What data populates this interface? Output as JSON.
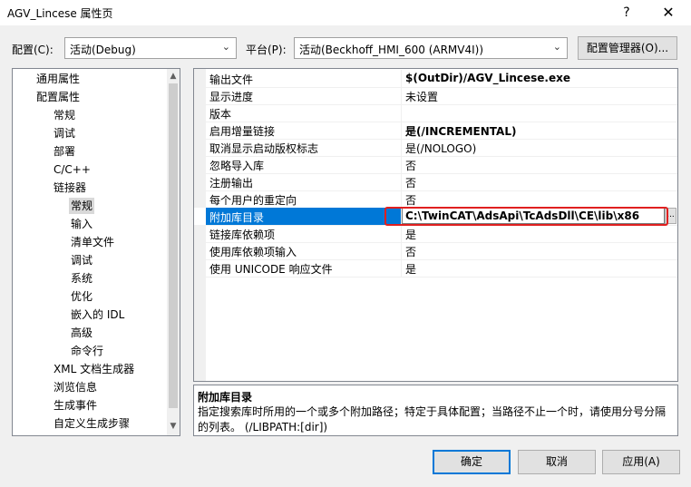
{
  "window": {
    "title": "AGV_Lincese 属性页",
    "help_glyph": "?",
    "close_glyph": "✕"
  },
  "config_bar": {
    "config_label": "配置(C):",
    "config_value": "活动(Debug)",
    "platform_label": "平台(P):",
    "platform_value": "活动(Beckhoff_HMI_600 (ARMV4I))",
    "config_manager_button": "配置管理器(O)..."
  },
  "tree": {
    "items": [
      {
        "label": "通用属性"
      },
      {
        "label": "配置属性"
      },
      {
        "label": "常规"
      },
      {
        "label": "调试"
      },
      {
        "label": "部署"
      },
      {
        "label": "C/C++"
      },
      {
        "label": "链接器"
      },
      {
        "label": "常规",
        "selected": true
      },
      {
        "label": "输入"
      },
      {
        "label": "清单文件"
      },
      {
        "label": "调试"
      },
      {
        "label": "系统"
      },
      {
        "label": "优化"
      },
      {
        "label": "嵌入的 IDL"
      },
      {
        "label": "高级"
      },
      {
        "label": "命令行"
      },
      {
        "label": "XML 文档生成器"
      },
      {
        "label": "浏览信息"
      },
      {
        "label": "生成事件"
      },
      {
        "label": "自定义生成步骤"
      }
    ]
  },
  "properties": {
    "rows": [
      {
        "name": "输出文件",
        "value": "$(OutDir)/AGV_Lincese.exe",
        "bold": true
      },
      {
        "name": "显示进度",
        "value": "未设置"
      },
      {
        "name": "版本",
        "value": ""
      },
      {
        "name": "启用增量链接",
        "value": "是(/INCREMENTAL)",
        "bold": true
      },
      {
        "name": "取消显示启动版权标志",
        "value": "是(/NOLOGO)"
      },
      {
        "name": "忽略导入库",
        "value": "否"
      },
      {
        "name": "注册输出",
        "value": "否"
      },
      {
        "name": "每个用户的重定向",
        "value": "否"
      },
      {
        "name": "附加库目录",
        "value": "C:\\TwinCAT\\AdsApi\\TcAdsDll\\CE\\lib\\x86",
        "selected": true,
        "bold": true
      },
      {
        "name": "链接库依赖项",
        "value": "是"
      },
      {
        "name": "使用库依赖项输入",
        "value": "否"
      },
      {
        "name": "使用 UNICODE 响应文件",
        "value": "是"
      }
    ],
    "edit_value": "C:\\TwinCAT\\AdsApi\\TcAdsDll\\CE\\lib\\x86",
    "ellipsis": "..."
  },
  "description": {
    "title": "附加库目录",
    "body": "指定搜索库时所用的一个或多个附加路径；特定于具体配置；当路径不止一个时，请使用分号分隔的列表。     (/LIBPATH:[dir])"
  },
  "buttons": {
    "ok": "确定",
    "cancel": "取消",
    "apply": "应用(A)"
  },
  "colors": {
    "selection": "#0078d7",
    "highlight_box": "#e02020"
  }
}
